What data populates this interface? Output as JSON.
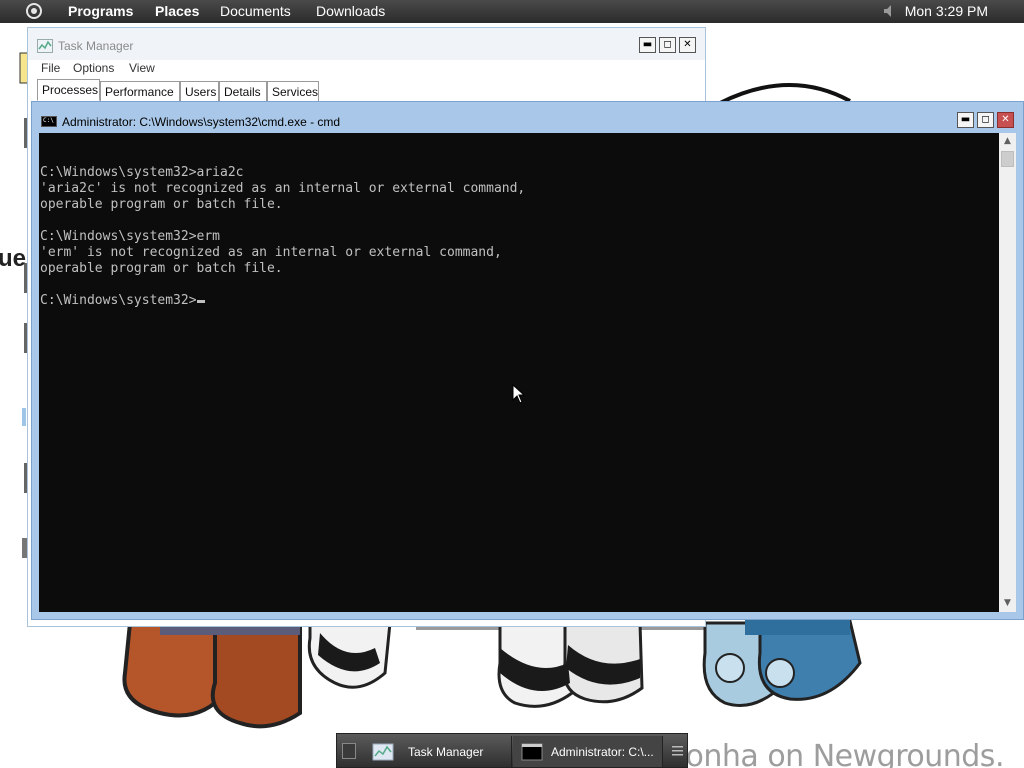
{
  "top_panel": {
    "items": [
      "Programs",
      "Places",
      "Documents",
      "Downloads"
    ],
    "clock": "Mon 3:29 PM",
    "volume_icon": "speaker-icon"
  },
  "wallpaper": {
    "partial_text": "ue",
    "watermark": "CheeyodaBoloAconha on Newgrounds."
  },
  "task_manager": {
    "title": "Task Manager",
    "menu": [
      "File",
      "Options",
      "View"
    ],
    "tabs": [
      "Processes",
      "Performance",
      "Users",
      "Details",
      "Services"
    ],
    "active_tab": "Processes"
  },
  "cmd": {
    "title": "Administrator: C:\\Windows\\system32\\cmd.exe - cmd",
    "lines": [
      "",
      "C:\\Windows\\system32>aria2c",
      "'aria2c' is not recognized as an internal or external command,",
      "operable program or batch file.",
      "",
      "C:\\Windows\\system32>erm",
      "'erm' is not recognized as an internal or external command,",
      "operable program or batch file.",
      "",
      "C:\\Windows\\system32>"
    ]
  },
  "window_buttons": {
    "minimize": "▬",
    "maximize": "◻",
    "close": "✕"
  },
  "taskbar": {
    "tasks": [
      "Task Manager",
      "Administrator: C:\\..."
    ]
  },
  "colors": {
    "cmd_frame": "#a9c7e8",
    "console_bg": "#0c0c0c",
    "console_text": "#c0c0c0",
    "close_button": "#c75050",
    "panel": "#2b2b2b"
  }
}
